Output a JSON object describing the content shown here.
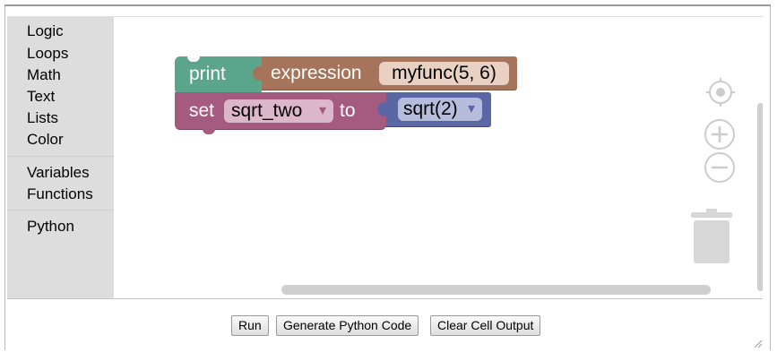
{
  "toolbox": {
    "items": [
      "Logic",
      "Loops",
      "Math",
      "Text",
      "Lists",
      "Color",
      "Variables",
      "Functions",
      "Python"
    ]
  },
  "blocks": {
    "print_label": "print",
    "expression_label": "expression",
    "expression_value": "myfunc(5, 6)",
    "set_label": "set",
    "variable_name": "sqrt_two",
    "to_label": "to",
    "sqrt_value": "sqrt(2)",
    "dropdown_arrow": "▾"
  },
  "buttons": {
    "run": "Run",
    "generate": "Generate Python Code",
    "clear": "Clear Cell Output"
  },
  "colors": {
    "print_block": "#5ba58c",
    "expression_block": "#a5745b",
    "set_block": "#a55b80",
    "sqrt_block": "#5b67a5",
    "toolbox_bg": "#dddddd"
  },
  "icons": {
    "recenter": "recenter-icon",
    "zoom_in": "zoom-in-icon",
    "zoom_out": "zoom-out-icon",
    "trash": "trash-icon"
  }
}
